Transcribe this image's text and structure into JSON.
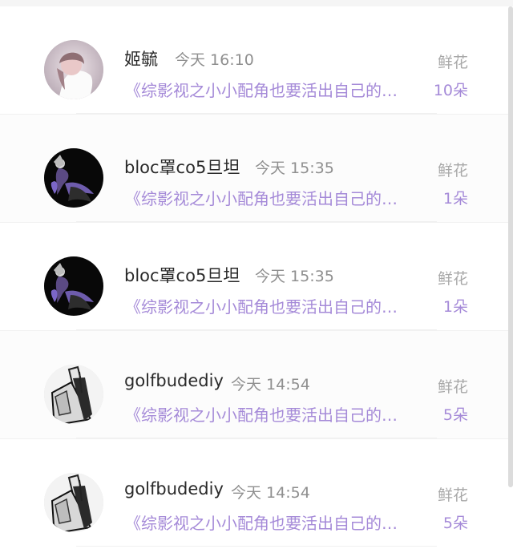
{
  "list": {
    "items": [
      {
        "name": "姬毓",
        "time": "今天 16:10",
        "type": "鲜花",
        "title": "《综影视之小小配角也要活出自己的…",
        "count": "10朵",
        "avatar": "avatar-image"
      },
      {
        "name": "bloc罩co5旦坦",
        "time": "今天 15:35",
        "type": "鲜花",
        "title": "《综影视之小小配角也要活出自己的…",
        "count": "1朵",
        "avatar": "avatar-image"
      },
      {
        "name": "bloc罩co5旦坦",
        "time": "今天 15:35",
        "type": "鲜花",
        "title": "《综影视之小小配角也要活出自己的…",
        "count": "1朵",
        "avatar": "avatar-image"
      },
      {
        "name": "golfbudediy",
        "time": "今天 14:54",
        "type": "鲜花",
        "title": "《综影视之小小配角也要活出自己的…",
        "count": "5朵",
        "avatar": "avatar-image"
      },
      {
        "name": "golfbudediy",
        "time": "今天 14:54",
        "type": "鲜花",
        "title": "《综影视之小小配角也要活出自己的…",
        "count": "5朵",
        "avatar": "avatar-image"
      }
    ]
  },
  "colors": {
    "accent": "#a58ad8",
    "name": "#2a2a2a",
    "muted": "#8f8f8f"
  }
}
